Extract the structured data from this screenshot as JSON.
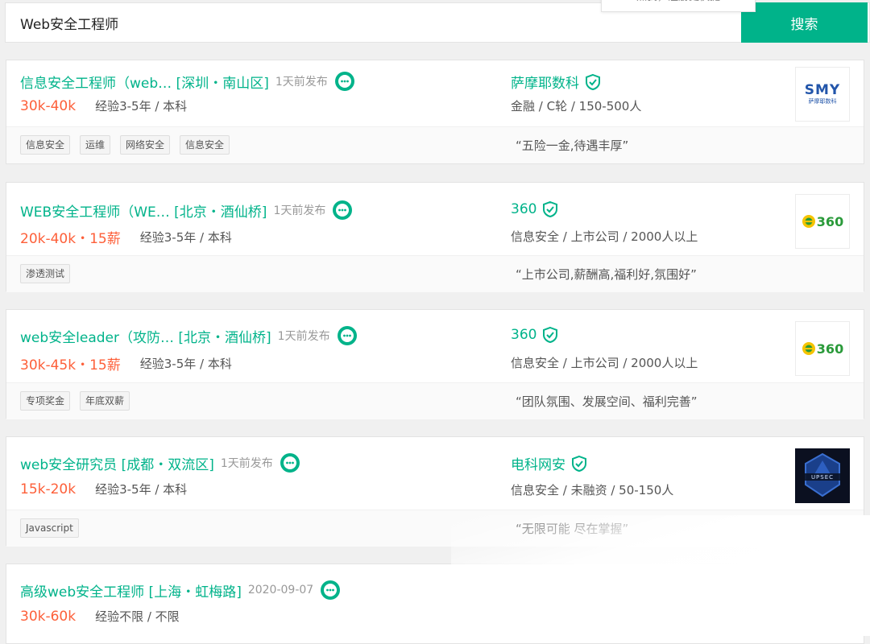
{
  "search": {
    "query": "Web安全工程师",
    "button_label": "搜索",
    "tooltip": "点我，注册更快捷"
  },
  "jobs": [
    {
      "title": "信息安全工程师（web… [深圳・南山区]",
      "posted": "1天前发布",
      "salary": "30k-40k",
      "requirements": "经验3-5年 / 本科",
      "company": "萨摩耶数科",
      "company_info": "金融 / C轮 / 150-500人",
      "tags": [
        "信息安全",
        "运维",
        "网络安全",
        "信息安全"
      ],
      "benefit": "“五险一金,待遇丰厚”",
      "logo": {
        "text_top": "SMY",
        "text_bottom": "萨摩耶数科"
      }
    },
    {
      "title": "WEB安全工程师（WE… [北京・酒仙桥]",
      "posted": "1天前发布",
      "salary": "20k-40k・15薪",
      "requirements": "经验3-5年 / 本科",
      "company": "360",
      "company_info": "信息安全 / 上市公司 / 2000人以上",
      "tags": [
        "渗透测试"
      ],
      "benefit": "“上市公司,薪酬高,福利好,氛围好”",
      "logo": {
        "text": "360"
      }
    },
    {
      "title": "web安全leader（攻防… [北京・酒仙桥]",
      "posted": "1天前发布",
      "salary": "30k-45k・15薪",
      "requirements": "经验3-5年 / 本科",
      "company": "360",
      "company_info": "信息安全 / 上市公司 / 2000人以上",
      "tags": [
        "专项奖金",
        "年底双薪"
      ],
      "benefit": "“团队氛围、发展空间、福利完善”",
      "logo": {
        "text": "360"
      }
    },
    {
      "title": "web安全研究员 [成都・双流区]",
      "posted": "1天前发布",
      "salary": "15k-20k",
      "requirements": "经验3-5年 / 本科",
      "company": "电科网安",
      "company_info": "信息安全 / 未融资 / 50-150人",
      "tags": [
        "Javascript"
      ],
      "benefit": "“无限可能 尽在掌握”",
      "logo": {
        "text": "UPSEC"
      }
    },
    {
      "title": "高级web安全工程师 [上海・虹梅路]",
      "posted": "2020-09-07",
      "salary": "30k-60k",
      "requirements": "经验不限 / 不限"
    }
  ],
  "colors": {
    "accent": "#00b38a",
    "salary": "#fd5f39"
  }
}
